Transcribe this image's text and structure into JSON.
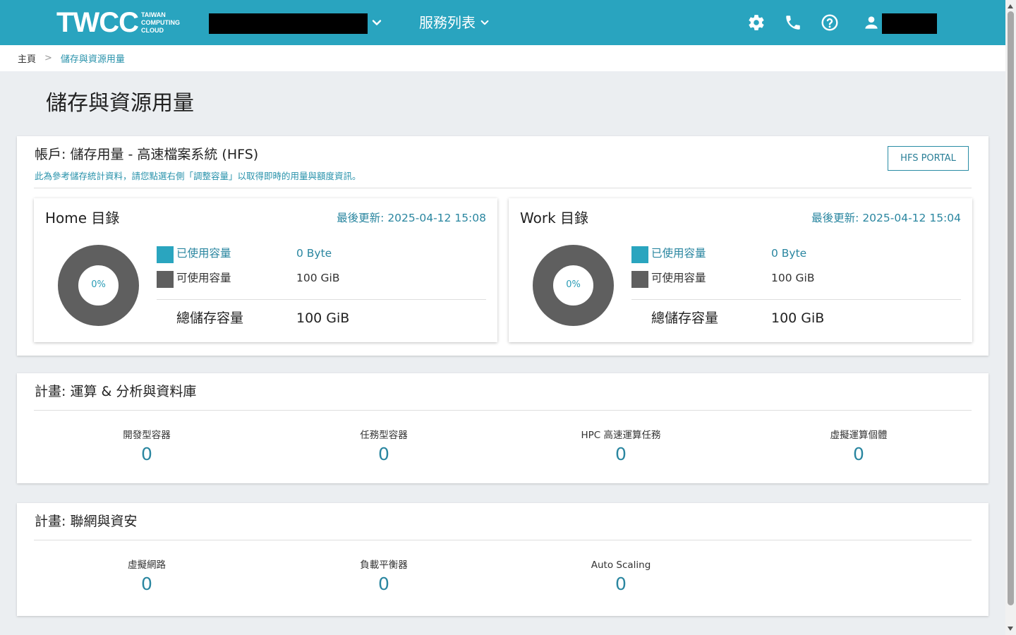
{
  "header": {
    "logo_main": "TWCC",
    "logo_sub": [
      "TAIWAN",
      "COMPUTING",
      "CLOUD"
    ],
    "service_menu": "服務列表",
    "icons": [
      "gear-icon",
      "phone-icon",
      "help-icon",
      "user-icon"
    ]
  },
  "breadcrumb": {
    "home": "主頁",
    "separator": ">",
    "current": "儲存與資源用量"
  },
  "page_title": "儲存與資源用量",
  "storage_card": {
    "title": "帳戶: 儲存用量 - 高速檔案系統 (HFS)",
    "subtitle": "此為參考儲存統計資料，請您點選右側「調整容量」以取得即時的用量與額度資訊。",
    "portal_button": "HFS PORTAL",
    "directories": [
      {
        "name": "Home 目錄",
        "updated": "最後更新: 2025-04-12 15:08",
        "percent_label": "0%",
        "used_fraction": 0,
        "used_label": "已使用容量",
        "used_value": "0 Byte",
        "avail_label": "可使用容量",
        "avail_value": "100 GiB",
        "total_label": "總儲存容量",
        "total_value": "100 GiB"
      },
      {
        "name": "Work 目錄",
        "updated": "最後更新: 2025-04-12 15:04",
        "percent_label": "0%",
        "used_fraction": 0,
        "used_label": "已使用容量",
        "used_value": "0 Byte",
        "avail_label": "可使用容量",
        "avail_value": "100 GiB",
        "total_label": "總儲存容量",
        "total_value": "100 GiB"
      }
    ]
  },
  "compute_card": {
    "title": "計畫: 運算 & 分析與資料庫",
    "items": [
      {
        "label": "開發型容器",
        "value": "0"
      },
      {
        "label": "任務型容器",
        "value": "0"
      },
      {
        "label": "HPC 高速運算任務",
        "value": "0"
      },
      {
        "label": "虛擬運算個體",
        "value": "0"
      }
    ]
  },
  "network_card": {
    "title": "計畫: 聯網與資安",
    "items": [
      {
        "label": "虛擬網路",
        "value": "0"
      },
      {
        "label": "負載平衡器",
        "value": "0"
      },
      {
        "label": "Auto Scaling",
        "value": "0"
      }
    ]
  },
  "colors": {
    "header_bg": "#29a4bf",
    "accent": "#2a86a0",
    "used_swatch": "#2aa5bf",
    "avail_swatch": "#5f5f5f"
  }
}
